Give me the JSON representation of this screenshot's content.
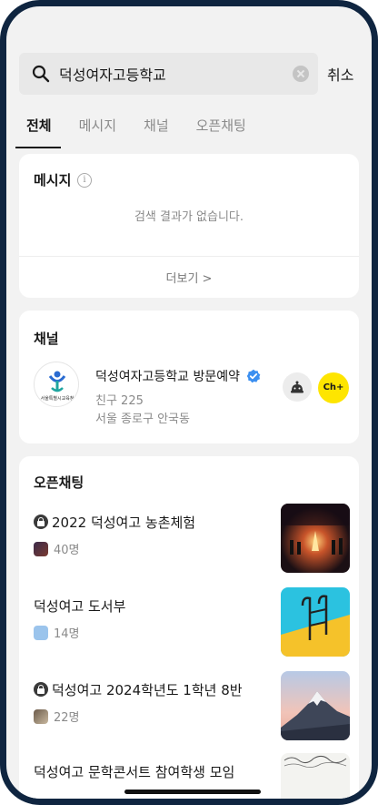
{
  "search": {
    "query": "덕성여자고등학교",
    "cancel_label": "취소"
  },
  "tabs": [
    {
      "label": "전체",
      "active": true
    },
    {
      "label": "메시지",
      "active": false
    },
    {
      "label": "채널",
      "active": false
    },
    {
      "label": "오픈채팅",
      "active": false
    }
  ],
  "messages": {
    "title": "메시지",
    "info_icon": "info-icon",
    "empty_text": "검색 결과가 없습니다.",
    "more_label": "더보기 >"
  },
  "channel": {
    "title": "채널",
    "name": "덕성여자고등학교 방문예약",
    "friends": "친구 225",
    "location": "서울 종로구 안국동",
    "logo_caption": "서울특별시교육청",
    "add_label": "Ch+"
  },
  "open_chat": {
    "title": "오픈채팅",
    "items": [
      {
        "title": "2022 덕성여고 농촌체험",
        "members": "40명",
        "locked": true
      },
      {
        "title": "덕성여고 도서부",
        "members": "14명",
        "locked": false
      },
      {
        "title": "덕성여고 2024학년도 1학년 8반",
        "members": "22명",
        "locked": true
      },
      {
        "title": "덕성여고 문학콘서트 참여학생 모임",
        "members": "",
        "locked": false
      }
    ]
  },
  "colors": {
    "accent_yellow": "#fee500",
    "verified_blue": "#3b8ff0",
    "frame": "#0f2540"
  }
}
